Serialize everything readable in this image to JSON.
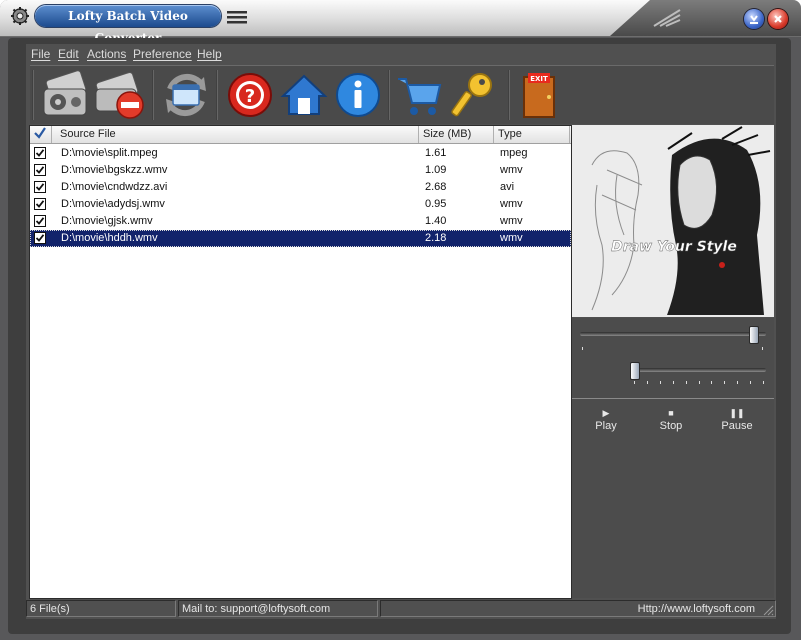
{
  "window": {
    "title": "Lofty Batch Video Converter"
  },
  "menu": [
    {
      "label": "File"
    },
    {
      "label": "Edit"
    },
    {
      "label": "Actions"
    },
    {
      "label": "Preference"
    },
    {
      "label": "Help"
    }
  ],
  "toolbar": {
    "buttons": [
      {
        "icon": "add-video-icon"
      },
      {
        "icon": "remove-video-icon"
      },
      {
        "icon": "convert-icon"
      },
      {
        "icon": "help-icon"
      },
      {
        "icon": "home-icon"
      },
      {
        "icon": "info-icon"
      },
      {
        "icon": "buy-cart-icon"
      },
      {
        "icon": "register-key-icon"
      },
      {
        "icon": "exit-door-icon"
      }
    ],
    "exit_label": "EXIT"
  },
  "file_list": {
    "columns": [
      "Source File",
      "Size (MB)",
      "Type"
    ],
    "rows": [
      {
        "file": "D:\\movie\\split.mpeg",
        "size": "1.61",
        "type": "mpeg",
        "checked": true,
        "selected": false
      },
      {
        "file": "D:\\movie\\bgskzz.wmv",
        "size": "1.09",
        "type": "wmv",
        "checked": true,
        "selected": false
      },
      {
        "file": "D:\\movie\\cndwdzz.avi",
        "size": "2.68",
        "type": "avi",
        "checked": true,
        "selected": false
      },
      {
        "file": "D:\\movie\\adydsj.wmv",
        "size": "0.95",
        "type": "wmv",
        "checked": true,
        "selected": false
      },
      {
        "file": "D:\\movie\\gjsk.wmv",
        "size": "1.40",
        "type": "wmv",
        "checked": true,
        "selected": false
      },
      {
        "file": "D:\\movie\\hddh.wmv",
        "size": "2.18",
        "type": "wmv",
        "checked": true,
        "selected": true
      }
    ]
  },
  "preview": {
    "overlay_text": "Draw Your Style"
  },
  "player": {
    "position_value": 0.95,
    "volume_value": 0.0,
    "buttons": {
      "play": "Play",
      "stop": "Stop",
      "pause": "Pause"
    }
  },
  "status": {
    "file_count": "6 File(s)",
    "mail": "Mail to: support@loftysoft.com",
    "url": "Http://www.loftysoft.com"
  },
  "colors": {
    "selection": "#12236b",
    "title_pill": "#2a5aa3",
    "panel": "#505050"
  }
}
